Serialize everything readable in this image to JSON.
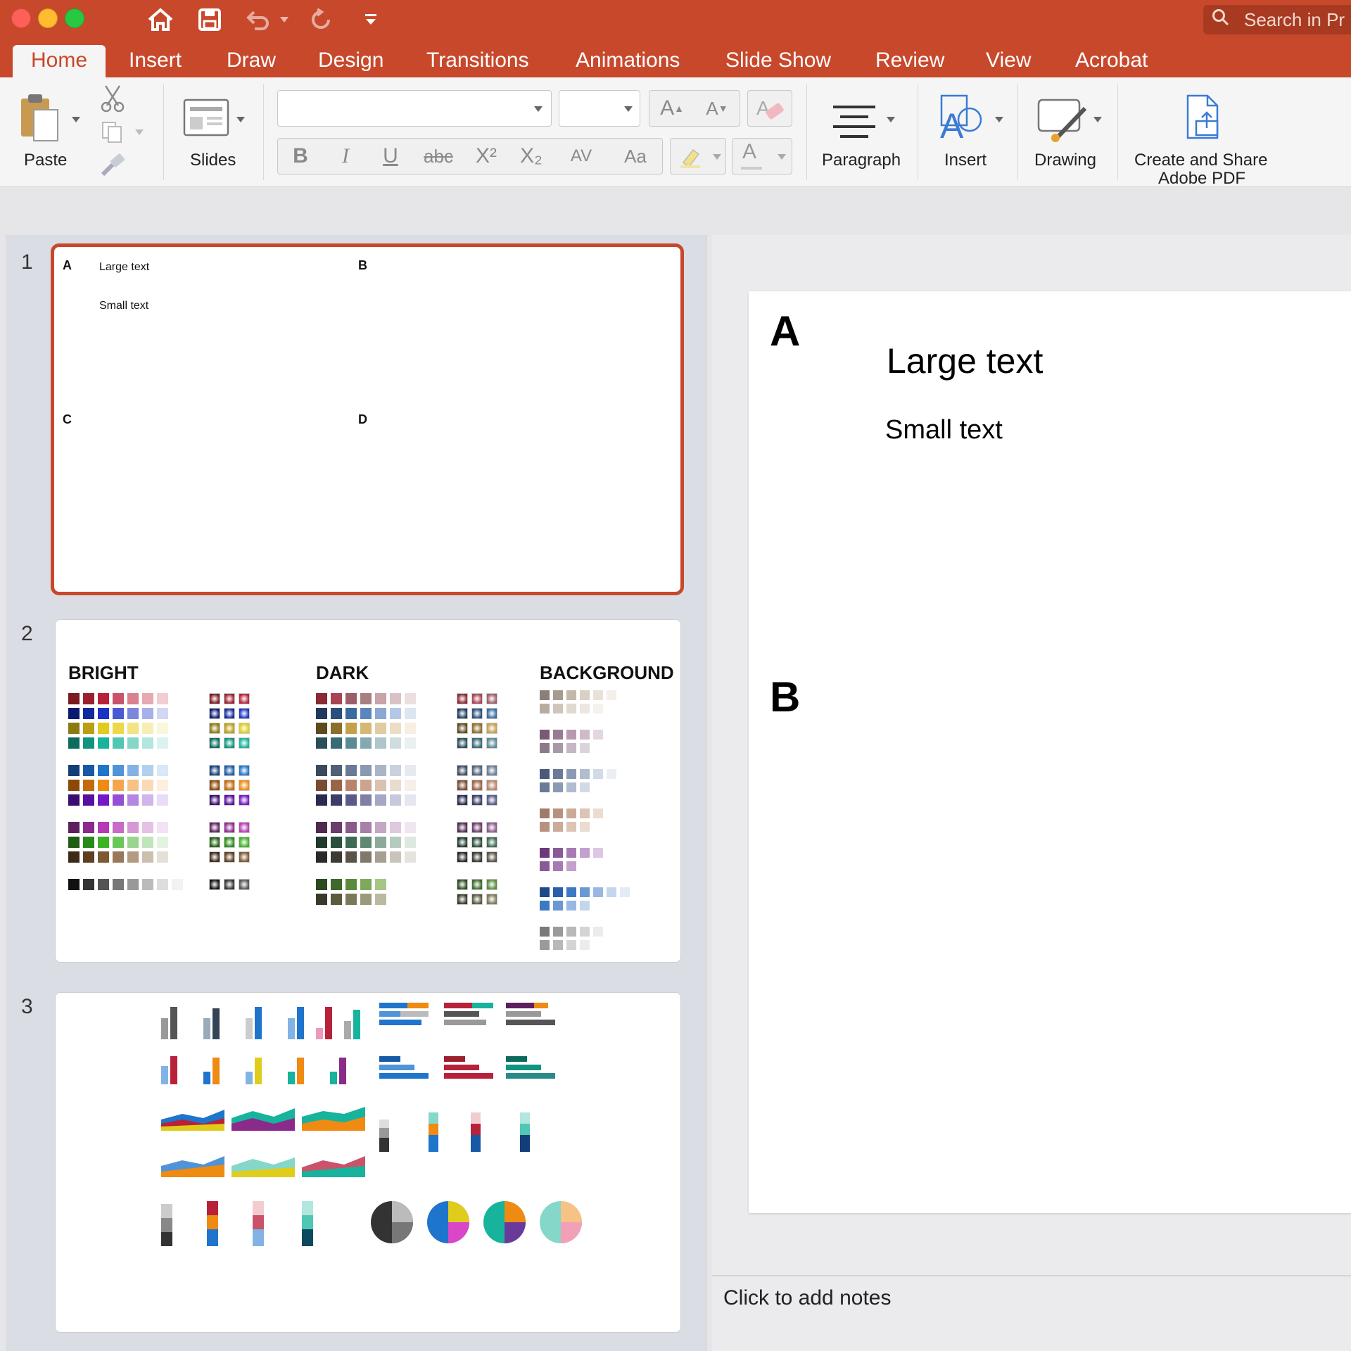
{
  "titlebar": {
    "search_placeholder": "Search in Pr",
    "traffic_colors": [
      "#fe5f57",
      "#febc2e",
      "#28c840"
    ]
  },
  "tabs": [
    {
      "label": "Home",
      "active": true
    },
    {
      "label": "Insert"
    },
    {
      "label": "Draw"
    },
    {
      "label": "Design"
    },
    {
      "label": "Transitions"
    },
    {
      "label": "Animations"
    },
    {
      "label": "Slide Show"
    },
    {
      "label": "Review"
    },
    {
      "label": "View"
    },
    {
      "label": "Acrobat"
    }
  ],
  "ribbon": {
    "paste_label": "Paste",
    "slides_label": "Slides",
    "font_name_value": "",
    "font_size_value": "",
    "font_buttons": [
      "B",
      "I",
      "U",
      "abc",
      "X²",
      "X₂",
      "AV",
      "Aa"
    ],
    "paragraph_label": "Paragraph",
    "insert_label": "Insert",
    "drawing_label": "Drawing",
    "pdf_label_line1": "Create and Share",
    "pdf_label_line2": "Adobe PDF"
  },
  "thumbnails": {
    "slide1": {
      "number": "1",
      "label_a": "A",
      "label_b": "B",
      "label_c": "C",
      "label_d": "D",
      "large_text": "Large text",
      "small_text": "Small text"
    },
    "slide2": {
      "number": "2",
      "bright": "BRIGHT",
      "dark": "DARK",
      "background": "BACKGROUND",
      "bright_rows": [
        [
          "#7b1a1f",
          "#9c1f2e",
          "#b8213a",
          "#c9546a",
          "#d9818f",
          "#e6a8b1",
          "#f1cdd2"
        ],
        [
          "#0a1a6e",
          "#0e2a9c",
          "#1a33c4",
          "#4a5bd1",
          "#7b87dd",
          "#a8b0e9",
          "#d2d7f4"
        ],
        [
          "#8a7a10",
          "#b8a012",
          "#e0cc1a",
          "#ecd84a",
          "#f2e484",
          "#f7eeb2",
          "#fbf7dc"
        ],
        [
          "#0d6b5e",
          "#10937f",
          "#17b39c",
          "#50c6b4",
          "#85d7ca",
          "#b3e6dd",
          "#dbf3ef"
        ],
        [
          "#123f78",
          "#1759a6",
          "#1f74cc",
          "#4f94d8",
          "#82b3e4",
          "#b0d0ee",
          "#dae8f7"
        ],
        [
          "#8a4a06",
          "#c36b0a",
          "#ef8a12",
          "#f3a64d",
          "#f7c286",
          "#fadab6",
          "#fdeede"
        ],
        [
          "#3a0d6e",
          "#5710a0",
          "#7419c8",
          "#9450d5",
          "#b486e1",
          "#d0b4ec",
          "#e9dcf6"
        ],
        [
          "#5e1f5e",
          "#8a2a8a",
          "#b43bb4",
          "#c76bc7",
          "#d699d6",
          "#e5c1e5",
          "#f3e2f3"
        ],
        [
          "#1f5e12",
          "#2a8a19",
          "#3bb423",
          "#6bc75a",
          "#99d68d",
          "#c1e5ba",
          "#e2f3df"
        ],
        [
          "#3d2a16",
          "#5e4020",
          "#7d5a33",
          "#98785a",
          "#b39b83",
          "#cdbfae",
          "#e6dfd7"
        ],
        [
          "#111111",
          "#333333",
          "#555555",
          "#777777",
          "#999999",
          "#bbbbbb",
          "#dddddd",
          "#f2f2f2"
        ]
      ],
      "dark_rows": [
        [
          "#8a2a33",
          "#a84453",
          "#9c5e6a",
          "#a8807f",
          "#c8a3a8",
          "#d9c2c4",
          "#ebdfe0"
        ],
        [
          "#1f3a5e",
          "#2a4f7d",
          "#3a6aa0",
          "#5a86bd",
          "#8aa8d3",
          "#b3c8e6",
          "#dce6f2"
        ],
        [
          "#5e4a1f",
          "#8a6e2a",
          "#c4a04a",
          "#d4b874",
          "#e0cca0",
          "#ecdec4",
          "#f6efe2"
        ],
        [
          "#2a4f5a",
          "#3a6a78",
          "#5a8a96",
          "#85a9b2",
          "#adc5cb",
          "#cfdde1",
          "#e9f0f2"
        ],
        [
          "#3a4a5e",
          "#4f6078",
          "#6a7a96",
          "#8a99b2",
          "#aab5ca",
          "#c9d1df",
          "#e6eaf0"
        ],
        [
          "#7a4a33",
          "#9c6447",
          "#b8856a",
          "#cca48e",
          "#dcc1b1",
          "#eadbd1",
          "#f6efe9"
        ],
        [
          "#2a2a4f",
          "#3d3d6a",
          "#5a5a8a",
          "#7f7fa8",
          "#a6a6c6",
          "#c9c9de",
          "#e6e6f0"
        ],
        [
          "#4f2a4f",
          "#6a3d6a",
          "#8a5a8a",
          "#a87fa8",
          "#c6a6c6",
          "#dec9de",
          "#f0e6f0"
        ],
        [
          "#1f3a2a",
          "#2a4f3a",
          "#3d6a52",
          "#5e8a72",
          "#8aab99",
          "#b5cbbe",
          "#dde8e1"
        ],
        [
          "#2a2a2a",
          "#3d3a33",
          "#5a5448",
          "#7f786b",
          "#a69f93",
          "#c9c4bb",
          "#e6e3de"
        ],
        [
          "#2a4a1f",
          "#3d6a2a",
          "#5a8a3d",
          "#7fa85a",
          "#a6c685"
        ],
        [
          "#3a3a2a",
          "#5a5a3d",
          "#7a7a5a",
          "#9a9a7a",
          "#babaa0"
        ]
      ],
      "bg_rows": [
        [
          "#8a8078",
          "#a69b8e",
          "#c4b8aa",
          "#d9cfc3",
          "#e8e1d8",
          "#f3efe9"
        ],
        [
          "#b8aca0",
          "#cfc5ba",
          "#e0d9d0",
          "#ece7e0",
          "#f5f2ee"
        ],
        [
          "#7a5a72",
          "#9a7a92",
          "#b89ab0",
          "#d0bac9",
          "#e4d6e0"
        ],
        [
          "#8a7a8a",
          "#a898a8",
          "#c4b6c4",
          "#dcd2dc"
        ],
        [
          "#4a5a7a",
          "#6a7a98",
          "#8a9ab4",
          "#b0bccf",
          "#d2dae6",
          "#ebeff4"
        ],
        [
          "#6a7a98",
          "#8a9ab4",
          "#b0bccf",
          "#d2dae6"
        ],
        [
          "#a07a6a",
          "#b8927f",
          "#ccaa98",
          "#ddc4b5",
          "#ebdcd2"
        ],
        [
          "#b8927f",
          "#ccaa98",
          "#ddc4b5",
          "#ebdcd2"
        ],
        [
          "#6a3a7a",
          "#8a5a98",
          "#a87ab4",
          "#c4a0cc",
          "#dcc6e2"
        ],
        [
          "#8a5a98",
          "#a87ab4",
          "#c4a0cc"
        ],
        [
          "#1f4a8a",
          "#2a5ea8",
          "#3d78c4",
          "#6a98d4",
          "#98b8e2",
          "#c4d6ee",
          "#e2ebf6"
        ],
        [
          "#3d78c4",
          "#6a98d4",
          "#98b8e2",
          "#c4d6ee"
        ],
        [
          "#7a7a7a",
          "#9a9a9a",
          "#b8b8b8",
          "#d4d4d4",
          "#ececec"
        ],
        [
          "#9a9a9a",
          "#b8b8b8",
          "#d4d4d4",
          "#ececec"
        ]
      ]
    },
    "slide3": {
      "number": "3"
    }
  },
  "main_slide": {
    "label_a": "A",
    "label_b": "B",
    "large_text": "Large text",
    "small_text": "Small text"
  },
  "notes": {
    "placeholder": "Click to add notes"
  }
}
